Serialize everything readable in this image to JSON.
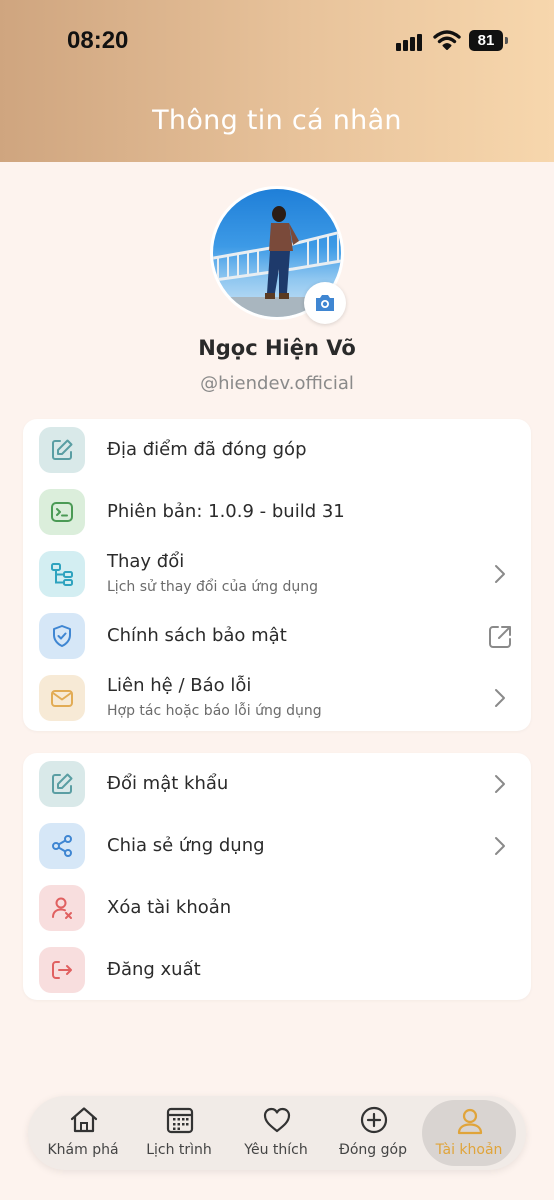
{
  "status": {
    "time": "08:20",
    "battery": "81"
  },
  "header": {
    "title": "Thông tin cá nhân"
  },
  "profile": {
    "name": "Ngọc Hiện Võ",
    "handle": "@hiendev.official"
  },
  "menu1": [
    {
      "icon": "edit-icon",
      "label": "Địa điểm đã đóng góp",
      "sub": "",
      "action": "none",
      "color": "#d9e9e9",
      "stroke": "#5a9ea3"
    },
    {
      "icon": "terminal-icon",
      "label": "Phiên bản: 1.0.9 - build 31",
      "sub": "",
      "action": "none",
      "color": "#dbeedb",
      "stroke": "#4b9a55"
    },
    {
      "icon": "tree-icon",
      "label": "Thay đổi",
      "sub": "Lịch sử thay đổi của ứng dụng",
      "action": "chevron",
      "color": "#d3eef2",
      "stroke": "#2ea3bf"
    },
    {
      "icon": "shield-check-icon",
      "label": "Chính sách bảo mật",
      "sub": "",
      "action": "external",
      "color": "#d6e7f7",
      "stroke": "#3f86d2"
    },
    {
      "icon": "mail-icon",
      "label": "Liên hệ / Báo lỗi",
      "sub": "Hợp tác hoặc báo lỗi ứng dụng",
      "action": "chevron",
      "color": "#f7ead6",
      "stroke": "#e2ac55"
    }
  ],
  "menu2": [
    {
      "icon": "edit-icon",
      "label": "Đổi mật khẩu",
      "sub": "",
      "action": "chevron",
      "color": "#d9e9e9",
      "stroke": "#5a9ea3"
    },
    {
      "icon": "share-icon",
      "label": "Chia sẻ ứng dụng",
      "sub": "",
      "action": "chevron",
      "color": "#d6e7f7",
      "stroke": "#3f86d2"
    },
    {
      "icon": "user-remove-icon",
      "label": "Xóa tài khoản",
      "sub": "",
      "action": "none",
      "color": "#f8dede",
      "stroke": "#e06060"
    },
    {
      "icon": "logout-icon",
      "label": "Đăng xuất",
      "sub": "",
      "action": "none",
      "color": "#f8dede",
      "stroke": "#e06060"
    }
  ],
  "tabs": [
    {
      "icon": "home-icon",
      "label": "Khám phá",
      "active": false
    },
    {
      "icon": "calendar-icon",
      "label": "Lịch trình",
      "active": false
    },
    {
      "icon": "heart-icon",
      "label": "Yêu thích",
      "active": false
    },
    {
      "icon": "plus-circle-icon",
      "label": "Đóng góp",
      "active": false
    },
    {
      "icon": "user-icon",
      "label": "Tài khoản",
      "active": true
    }
  ],
  "colors": {
    "accent": "#e0a43a",
    "header_start": "#cfa57f",
    "header_end": "#f7d7ad",
    "background": "#fdf3ee"
  }
}
